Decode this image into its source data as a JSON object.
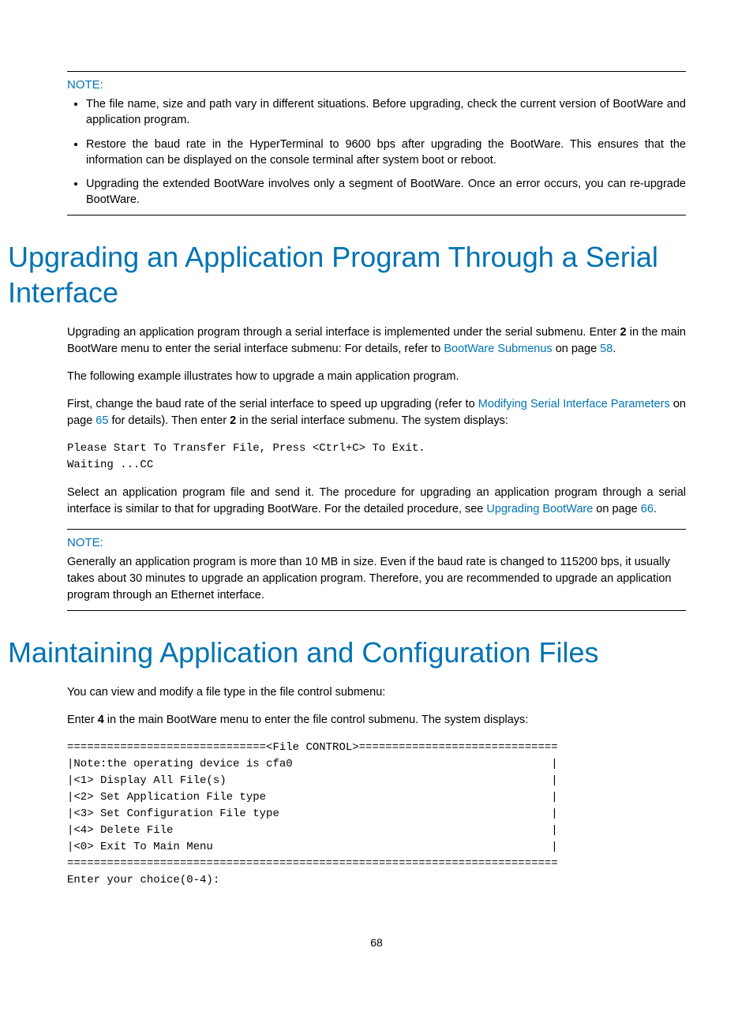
{
  "note1": {
    "label": "NOTE:",
    "items": [
      "The file name, size and path vary in different situations. Before upgrading, check the current version of BootWare and application program.",
      "Restore the baud rate in the HyperTerminal to 9600 bps after upgrading the BootWare. This ensures that the information can be displayed on the console terminal after system boot or reboot.",
      "Upgrading the extended BootWare involves only a segment of BootWare. Once an error occurs, you can re-upgrade BootWare."
    ]
  },
  "heading1": "Upgrading an Application Program Through a Serial Interface",
  "para1a": "Upgrading an application program through a serial interface is implemented under the serial submenu. Enter ",
  "para1_b": "2",
  "para1c": " in the main BootWare menu to enter the serial interface submenu: For details, refer to ",
  "link1": "BootWare Submenus",
  "para1d": " on page ",
  "link1page": "58",
  "para1e": ".",
  "para2": "The following example illustrates how to upgrade a main application program.",
  "para3a": "First, change the baud rate of the serial interface to speed up upgrading (refer to ",
  "link2": "Modifying Serial Interface Parameters",
  "para3b": " on page ",
  "link2page": "65",
  "para3c": " for details). Then enter ",
  "para3_b": "2",
  "para3d": " in the serial interface submenu. The system displays:",
  "code1": "Please Start To Transfer File, Press <Ctrl+C> To Exit.\nWaiting ...CC",
  "para4a": "Select an application program file and send it. The procedure for upgrading an application program through a serial interface is similar to that for upgrading BootWare. For the detailed procedure, see ",
  "link3": "Upgrading BootWare",
  "para4b": " on page ",
  "link3page": "66",
  "para4c": ".",
  "note2": {
    "label": "NOTE:",
    "body": "Generally an application program is more than 10 MB in size. Even if the baud rate is changed to 115200 bps, it usually takes about 30 minutes to upgrade an application program. Therefore, you are recommended to upgrade an application program through an Ethernet interface."
  },
  "heading2": "Maintaining Application and Configuration Files",
  "para5": "You can view and modify a file type in the file control submenu:",
  "para6a": "Enter ",
  "para6_b": "4",
  "para6b": " in the main BootWare menu to enter the file control submenu. The system displays:",
  "code2": "==============================<File CONTROL>==============================\n|Note:the operating device is cfa0                                       |\n|<1> Display All File(s)                                                 |\n|<2> Set Application File type                                           |\n|<3> Set Configuration File type                                         |\n|<4> Delete File                                                         |\n|<0> Exit To Main Menu                                                   |\n==========================================================================\nEnter your choice(0-4):",
  "pagenum": "68"
}
